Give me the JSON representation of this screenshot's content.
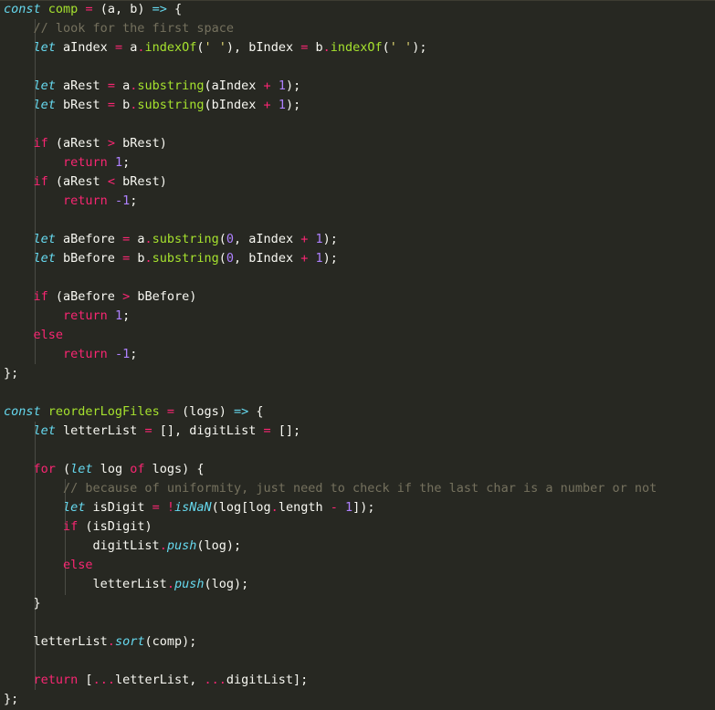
{
  "editor": {
    "lines": [
      [
        {
          "t": "const",
          "c": "kw"
        },
        {
          "t": " "
        },
        {
          "t": "comp",
          "c": "fn"
        },
        {
          "t": " "
        },
        {
          "t": "=",
          "c": "op"
        },
        {
          "t": " (a, b) "
        },
        {
          "t": "=>",
          "c": "kw"
        },
        {
          "t": " {"
        }
      ],
      [
        {
          "t": "    "
        },
        {
          "t": "// look for the first space",
          "c": "cmt"
        }
      ],
      [
        {
          "t": "    "
        },
        {
          "t": "let",
          "c": "kw"
        },
        {
          "t": " aIndex "
        },
        {
          "t": "=",
          "c": "op"
        },
        {
          "t": " a"
        },
        {
          "t": ".",
          "c": "op"
        },
        {
          "t": "indexOf",
          "c": "fn"
        },
        {
          "t": "("
        },
        {
          "t": "' '",
          "c": "str"
        },
        {
          "t": "), bIndex "
        },
        {
          "t": "=",
          "c": "op"
        },
        {
          "t": " b"
        },
        {
          "t": ".",
          "c": "op"
        },
        {
          "t": "indexOf",
          "c": "fn"
        },
        {
          "t": "("
        },
        {
          "t": "' '",
          "c": "str"
        },
        {
          "t": ");"
        }
      ],
      [],
      [
        {
          "t": "    "
        },
        {
          "t": "let",
          "c": "kw"
        },
        {
          "t": " aRest "
        },
        {
          "t": "=",
          "c": "op"
        },
        {
          "t": " a"
        },
        {
          "t": ".",
          "c": "op"
        },
        {
          "t": "substring",
          "c": "fn"
        },
        {
          "t": "(aIndex "
        },
        {
          "t": "+",
          "c": "op"
        },
        {
          "t": " "
        },
        {
          "t": "1",
          "c": "num"
        },
        {
          "t": ");"
        }
      ],
      [
        {
          "t": "    "
        },
        {
          "t": "let",
          "c": "kw"
        },
        {
          "t": " bRest "
        },
        {
          "t": "=",
          "c": "op"
        },
        {
          "t": " b"
        },
        {
          "t": ".",
          "c": "op"
        },
        {
          "t": "substring",
          "c": "fn"
        },
        {
          "t": "(bIndex "
        },
        {
          "t": "+",
          "c": "op"
        },
        {
          "t": " "
        },
        {
          "t": "1",
          "c": "num"
        },
        {
          "t": ");"
        }
      ],
      [],
      [
        {
          "t": "    "
        },
        {
          "t": "if",
          "c": "ctrl"
        },
        {
          "t": " (aRest "
        },
        {
          "t": ">",
          "c": "op"
        },
        {
          "t": " bRest)"
        }
      ],
      [
        {
          "t": "        "
        },
        {
          "t": "return",
          "c": "ctrl"
        },
        {
          "t": " "
        },
        {
          "t": "1",
          "c": "num"
        },
        {
          "t": ";"
        }
      ],
      [
        {
          "t": "    "
        },
        {
          "t": "if",
          "c": "ctrl"
        },
        {
          "t": " (aRest "
        },
        {
          "t": "<",
          "c": "op"
        },
        {
          "t": " bRest)"
        }
      ],
      [
        {
          "t": "        "
        },
        {
          "t": "return",
          "c": "ctrl"
        },
        {
          "t": " "
        },
        {
          "t": "-1",
          "c": "num"
        },
        {
          "t": ";"
        }
      ],
      [],
      [
        {
          "t": "    "
        },
        {
          "t": "let",
          "c": "kw"
        },
        {
          "t": " aBefore "
        },
        {
          "t": "=",
          "c": "op"
        },
        {
          "t": " a"
        },
        {
          "t": ".",
          "c": "op"
        },
        {
          "t": "substring",
          "c": "fn"
        },
        {
          "t": "("
        },
        {
          "t": "0",
          "c": "num"
        },
        {
          "t": ", aIndex "
        },
        {
          "t": "+",
          "c": "op"
        },
        {
          "t": " "
        },
        {
          "t": "1",
          "c": "num"
        },
        {
          "t": ");"
        }
      ],
      [
        {
          "t": "    "
        },
        {
          "t": "let",
          "c": "kw"
        },
        {
          "t": " bBefore "
        },
        {
          "t": "=",
          "c": "op"
        },
        {
          "t": " b"
        },
        {
          "t": ".",
          "c": "op"
        },
        {
          "t": "substring",
          "c": "fn"
        },
        {
          "t": "("
        },
        {
          "t": "0",
          "c": "num"
        },
        {
          "t": ", bIndex "
        },
        {
          "t": "+",
          "c": "op"
        },
        {
          "t": " "
        },
        {
          "t": "1",
          "c": "num"
        },
        {
          "t": ");"
        }
      ],
      [],
      [
        {
          "t": "    "
        },
        {
          "t": "if",
          "c": "ctrl"
        },
        {
          "t": " (aBefore "
        },
        {
          "t": ">",
          "c": "op"
        },
        {
          "t": " bBefore)"
        }
      ],
      [
        {
          "t": "        "
        },
        {
          "t": "return",
          "c": "ctrl"
        },
        {
          "t": " "
        },
        {
          "t": "1",
          "c": "num"
        },
        {
          "t": ";"
        }
      ],
      [
        {
          "t": "    "
        },
        {
          "t": "else",
          "c": "ctrl"
        }
      ],
      [
        {
          "t": "        "
        },
        {
          "t": "return",
          "c": "ctrl"
        },
        {
          "t": " "
        },
        {
          "t": "-1",
          "c": "num"
        },
        {
          "t": ";"
        }
      ],
      [
        {
          "t": "};"
        }
      ],
      [],
      [
        {
          "t": "const",
          "c": "kw"
        },
        {
          "t": " "
        },
        {
          "t": "reorderLogFiles",
          "c": "fn"
        },
        {
          "t": " "
        },
        {
          "t": "=",
          "c": "op"
        },
        {
          "t": " (logs) "
        },
        {
          "t": "=>",
          "c": "kw"
        },
        {
          "t": " {"
        }
      ],
      [
        {
          "t": "    "
        },
        {
          "t": "let",
          "c": "kw"
        },
        {
          "t": " letterList "
        },
        {
          "t": "=",
          "c": "op"
        },
        {
          "t": " [], digitList "
        },
        {
          "t": "=",
          "c": "op"
        },
        {
          "t": " [];"
        }
      ],
      [],
      [
        {
          "t": "    "
        },
        {
          "t": "for",
          "c": "ctrl"
        },
        {
          "t": " ("
        },
        {
          "t": "let",
          "c": "kw"
        },
        {
          "t": " log "
        },
        {
          "t": "of",
          "c": "ctrl"
        },
        {
          "t": " logs) {"
        }
      ],
      [
        {
          "t": "        "
        },
        {
          "t": "// because of uniformity, just need to check if the last char is a number or not",
          "c": "cmt"
        }
      ],
      [
        {
          "t": "        "
        },
        {
          "t": "let",
          "c": "kw"
        },
        {
          "t": " isDigit "
        },
        {
          "t": "=",
          "c": "op"
        },
        {
          "t": " "
        },
        {
          "t": "!",
          "c": "op"
        },
        {
          "t": "isNaN",
          "c": "kw"
        },
        {
          "t": "(log[log"
        },
        {
          "t": ".",
          "c": "op"
        },
        {
          "t": "length "
        },
        {
          "t": "-",
          "c": "op"
        },
        {
          "t": " "
        },
        {
          "t": "1",
          "c": "num"
        },
        {
          "t": "]);"
        }
      ],
      [
        {
          "t": "        "
        },
        {
          "t": "if",
          "c": "ctrl"
        },
        {
          "t": " (isDigit)"
        }
      ],
      [
        {
          "t": "            digitList"
        },
        {
          "t": ".",
          "c": "op"
        },
        {
          "t": "push",
          "c": "kw"
        },
        {
          "t": "(log);"
        }
      ],
      [
        {
          "t": "        "
        },
        {
          "t": "else",
          "c": "ctrl"
        }
      ],
      [
        {
          "t": "            letterList"
        },
        {
          "t": ".",
          "c": "op"
        },
        {
          "t": "push",
          "c": "kw"
        },
        {
          "t": "(log);"
        }
      ],
      [
        {
          "t": "    }"
        }
      ],
      [],
      [
        {
          "t": "    letterList"
        },
        {
          "t": ".",
          "c": "op"
        },
        {
          "t": "sort",
          "c": "kw"
        },
        {
          "t": "(comp);"
        }
      ],
      [],
      [
        {
          "t": "    "
        },
        {
          "t": "return",
          "c": "ctrl"
        },
        {
          "t": " ["
        },
        {
          "t": "...",
          "c": "op"
        },
        {
          "t": "letterList, "
        },
        {
          "t": "...",
          "c": "op"
        },
        {
          "t": "digitList];"
        }
      ],
      [
        {
          "t": "};"
        }
      ]
    ]
  }
}
